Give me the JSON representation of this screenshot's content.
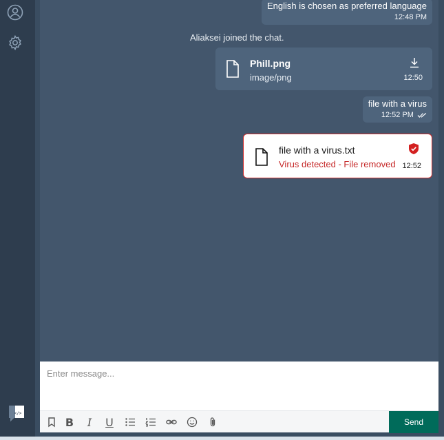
{
  "messages": [
    {
      "text": "English is chosen as preferred language",
      "time": "12:48 PM"
    },
    {
      "text": "file with a virus",
      "time": "12:52 PM"
    }
  ],
  "system_message": "Aliaksei joined the chat.",
  "file_message": {
    "name": "Phill.png",
    "type": "image/png",
    "time": "12:50"
  },
  "virus_message": {
    "name": "file with a virus.txt",
    "warning": "Virus detected - File removed",
    "time": "12:52"
  },
  "composer": {
    "placeholder": "Enter message...",
    "send_label": "Send"
  },
  "toolbar": {
    "bold": "B",
    "italic": "I",
    "underline": "U"
  },
  "icons": {
    "profile": "user-circle-icon",
    "settings": "gear-icon",
    "brand": "chat-logo-icon",
    "download": "download-icon",
    "file": "file-icon",
    "shield": "shield-check-icon"
  },
  "colors": {
    "send": "#006b5a",
    "warning": "#c62828"
  }
}
